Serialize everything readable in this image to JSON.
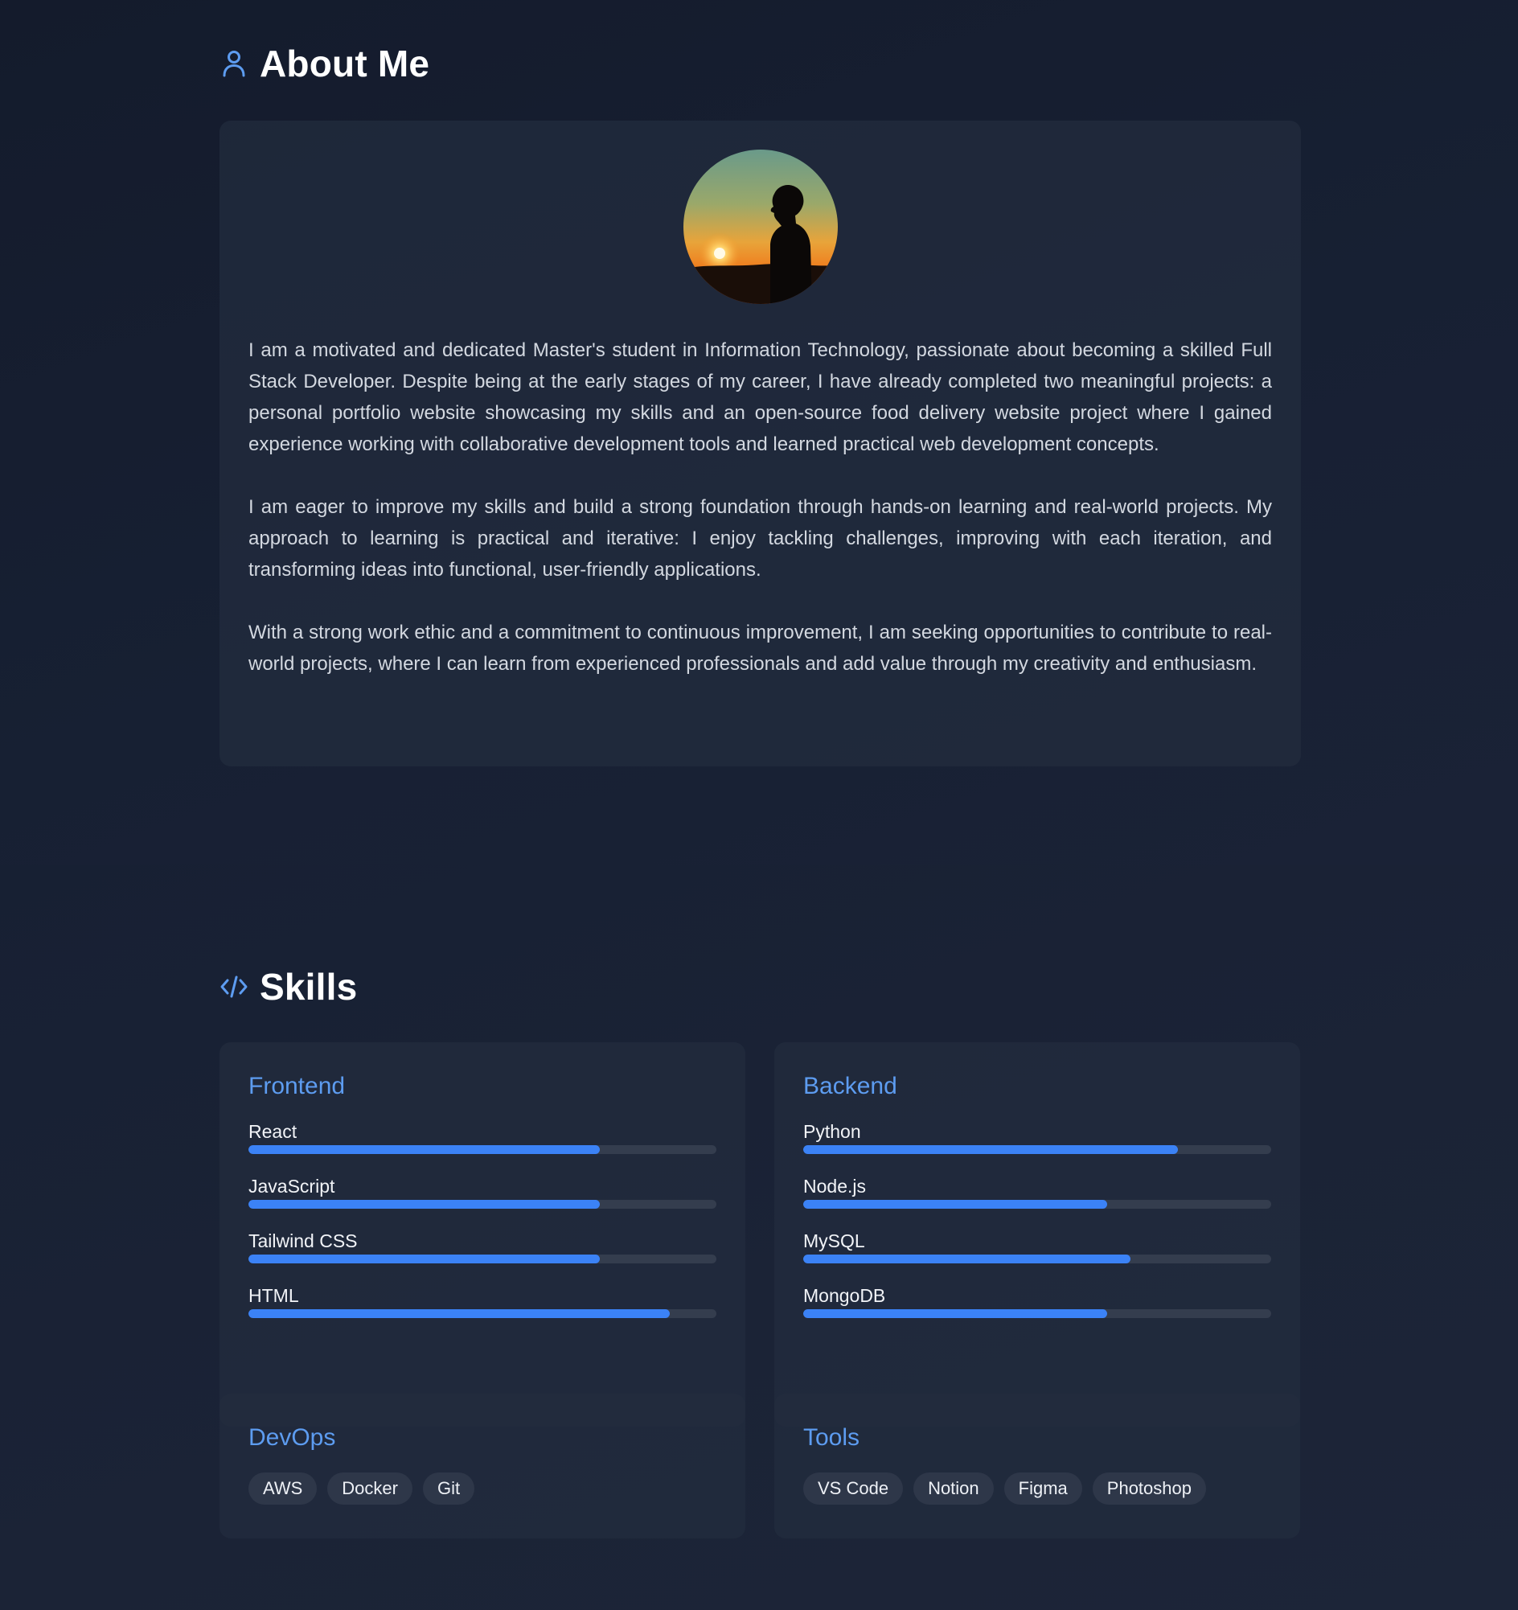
{
  "about": {
    "title": "About Me",
    "icon": "user-icon",
    "accent": "#5d9cf0",
    "paragraphs": [
      "I am a motivated and dedicated Master's student in Information Technology, passionate about becoming a skilled Full Stack Developer. Despite being at the early stages of my career, I have already completed two meaningful projects: a personal portfolio website showcasing my skills and an open-source food delivery website project where I gained experience working with collaborative development tools and learned practical web development concepts.",
      "I am eager to improve my skills and build a strong foundation through hands-on learning and real-world projects. My approach to learning is practical and iterative: I enjoy tackling challenges, improving with each iteration, and transforming ideas into functional, user-friendly applications.",
      "With a strong work ethic and a commitment to continuous improvement, I am seeking opportunities to contribute to real-world projects, where I can learn from experienced professionals and add value through my creativity and enthusiasm."
    ]
  },
  "skills": {
    "title": "Skills",
    "icon": "code-icon",
    "bar_color": "#3b82f6",
    "frontend": {
      "title": "Frontend",
      "items": [
        {
          "name": "React",
          "level": 0.75
        },
        {
          "name": "JavaScript",
          "level": 0.75
        },
        {
          "name": "Tailwind CSS",
          "level": 0.75
        },
        {
          "name": "HTML",
          "level": 0.9
        }
      ]
    },
    "backend": {
      "title": "Backend",
      "items": [
        {
          "name": "Python",
          "level": 0.8
        },
        {
          "name": "Node.js",
          "level": 0.65
        },
        {
          "name": "MySQL",
          "level": 0.7
        },
        {
          "name": "MongoDB",
          "level": 0.65
        }
      ]
    },
    "devops": {
      "title": "DevOps",
      "tags": [
        "AWS",
        "Docker",
        "Git"
      ]
    },
    "tools": {
      "title": "Tools",
      "tags": [
        "VS Code",
        "Notion",
        "Figma",
        "Photoshop"
      ]
    }
  }
}
